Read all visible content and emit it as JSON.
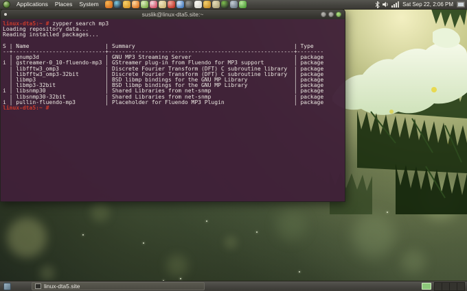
{
  "accent_colors": {
    "terminal_background": "#3F2038",
    "terminal_text": "#EAE6E0",
    "terminal_prompt": "#CB3B2C",
    "workspace_active": "#8DC87B"
  },
  "top_panel": {
    "distro_menu_name": "distro-menu",
    "menus": [
      {
        "label": "Applications"
      },
      {
        "label": "Places"
      },
      {
        "label": "System"
      }
    ],
    "launchers": [
      {
        "name": "launcher-firefox",
        "c1": "#d96f1f",
        "c2": "#f4b653"
      },
      {
        "name": "launcher-2",
        "c1": "#2b3a4a",
        "c2": "#7fd0e8"
      },
      {
        "name": "launcher-3",
        "c1": "#d99a2b",
        "c2": "#f6d06a"
      },
      {
        "name": "launcher-4",
        "c1": "#e07b28",
        "c2": "#ffd9a0"
      },
      {
        "name": "launcher-5",
        "c1": "#7fb04d",
        "c2": "#dff0c0"
      },
      {
        "name": "launcher-6",
        "c1": "#d4536a",
        "c2": "#f2dce2"
      },
      {
        "name": "launcher-7",
        "c1": "#cdb97a",
        "c2": "#efe6c2"
      },
      {
        "name": "launcher-8",
        "c1": "#c23b2e",
        "c2": "#f0a89e"
      },
      {
        "name": "launcher-9",
        "c1": "#4a7fc0",
        "c2": "#d8e6f4"
      },
      {
        "name": "launcher-10",
        "c1": "#4a4a46",
        "c2": "#9a9a94"
      },
      {
        "name": "launcher-11",
        "c1": "#d8d7cf",
        "c2": "#f7f6f0"
      },
      {
        "name": "launcher-12",
        "c1": "#c8902a",
        "c2": "#f2cf6e"
      },
      {
        "name": "launcher-13",
        "c1": "#b2a87e",
        "c2": "#e4dcb8"
      },
      {
        "name": "launcher-14",
        "c1": "#2f3a2a",
        "c2": "#7fc050"
      },
      {
        "name": "launcher-15",
        "c1": "#6f7c89",
        "c2": "#c4ccd4"
      },
      {
        "name": "launcher-16",
        "c1": "#55a43e",
        "c2": "#b8e69c"
      }
    ],
    "indicator_icons": [
      "bluetooth-icon",
      "volume-icon",
      "network-signal-icon"
    ],
    "clock": "Sat Sep 22, 2:06 PM",
    "right_icon": "display-settings-icon"
  },
  "terminal_window": {
    "title": "suslik@linux-dta5.site:~",
    "window_buttons": [
      "minimize",
      "maximize",
      "close"
    ],
    "terminal": {
      "prompt": "linux-dta5:~ #",
      "command": "zypper search mp3",
      "output_lines": [
        "Loading repository data...",
        "Reading installed packages..."
      ],
      "table": {
        "headers": {
          "status": "S",
          "name": "Name",
          "summary": "Summary",
          "type": "Type"
        },
        "col_widths": {
          "status": 1,
          "name": 26,
          "summary": 54,
          "type": 7
        },
        "rows": [
          {
            "status": "",
            "name": "gnump3d",
            "summary": "GNU MP3 Streaming Server",
            "type": "package"
          },
          {
            "status": "i",
            "name": "gstreamer-0_10-fluendo-mp3",
            "summary": "GStreamer plug-in from Fluendo for MP3 support",
            "type": "package"
          },
          {
            "status": "",
            "name": "libfftw3_omp3",
            "summary": "Discrete Fourier Transform (DFT) C subroutine library",
            "type": "package"
          },
          {
            "status": "",
            "name": "libfftw3_omp3-32bit",
            "summary": "Discrete Fourier Transform (DFT) C subroutine library",
            "type": "package"
          },
          {
            "status": "",
            "name": "libmp3",
            "summary": "BSD libmp bindings for the GNU MP Library",
            "type": "package"
          },
          {
            "status": "",
            "name": "libmp3-32bit",
            "summary": "BSD libmp bindings for the GNU MP Library",
            "type": "package"
          },
          {
            "status": "i",
            "name": "libsnmp30",
            "summary": "Shared Libraries from net-snmp",
            "type": "package"
          },
          {
            "status": "",
            "name": "libsnmp30-32bit",
            "summary": "Shared Libraries from net-snmp",
            "type": "package"
          },
          {
            "status": "i",
            "name": "pullin-fluendo-mp3",
            "summary": "Placeholder for Fluendo MP3 Plugin",
            "type": "package"
          }
        ]
      },
      "final_prompt": "linux-dta5:~ #"
    }
  },
  "taskbar": {
    "window_button": {
      "label": "linux-dta5.site"
    },
    "workspace_count": 4
  }
}
